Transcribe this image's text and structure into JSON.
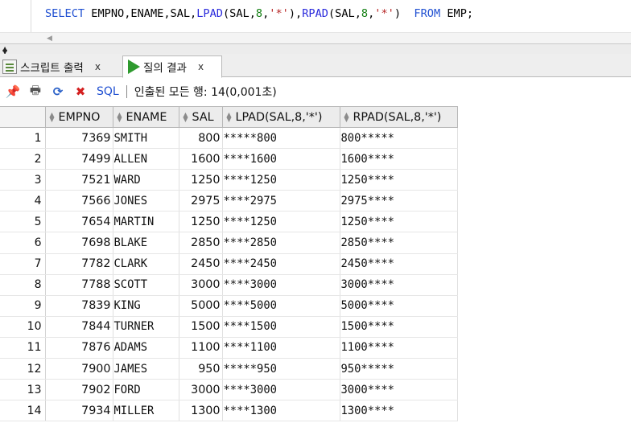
{
  "editor": {
    "sql_tokens": [
      {
        "t": "SELECT ",
        "c": "kw"
      },
      {
        "t": "EMPNO,ENAME,SAL,",
        "c": ""
      },
      {
        "t": "LPAD",
        "c": "fn"
      },
      {
        "t": "(SAL,",
        "c": ""
      },
      {
        "t": "8",
        "c": "num"
      },
      {
        "t": ",",
        "c": ""
      },
      {
        "t": "'*'",
        "c": "str"
      },
      {
        "t": "),",
        "c": ""
      },
      {
        "t": "RPAD",
        "c": "fn"
      },
      {
        "t": "(SAL,",
        "c": ""
      },
      {
        "t": "8",
        "c": "num"
      },
      {
        "t": ",",
        "c": ""
      },
      {
        "t": "'*'",
        "c": "str"
      },
      {
        "t": ")  ",
        "c": ""
      },
      {
        "t": "FROM ",
        "c": "kw"
      },
      {
        "t": "EMP;",
        "c": ""
      }
    ]
  },
  "tabs": [
    {
      "label": "스크립트 출력",
      "close": "x",
      "icon": "script-output-icon"
    },
    {
      "label": "질의 결과",
      "close": "x",
      "icon": "run-query-icon"
    }
  ],
  "toolbar": {
    "sql_label": "SQL",
    "status": "인출된 모든 행: 14(0,001초)",
    "icons": [
      "pin-icon",
      "print-icon",
      "refresh-icon",
      "delete-icon"
    ]
  },
  "grid": {
    "columns": [
      "EMPNO",
      "ENAME",
      "SAL",
      "LPAD(SAL,8,'*')",
      "RPAD(SAL,8,'*')"
    ],
    "rows": [
      [
        "1",
        "7369",
        "SMITH",
        "800",
        "*****800",
        "800*****"
      ],
      [
        "2",
        "7499",
        "ALLEN",
        "1600",
        "****1600",
        "1600****"
      ],
      [
        "3",
        "7521",
        "WARD",
        "1250",
        "****1250",
        "1250****"
      ],
      [
        "4",
        "7566",
        "JONES",
        "2975",
        "****2975",
        "2975****"
      ],
      [
        "5",
        "7654",
        "MARTIN",
        "1250",
        "****1250",
        "1250****"
      ],
      [
        "6",
        "7698",
        "BLAKE",
        "2850",
        "****2850",
        "2850****"
      ],
      [
        "7",
        "7782",
        "CLARK",
        "2450",
        "****2450",
        "2450****"
      ],
      [
        "8",
        "7788",
        "SCOTT",
        "3000",
        "****3000",
        "3000****"
      ],
      [
        "9",
        "7839",
        "KING",
        "5000",
        "****5000",
        "5000****"
      ],
      [
        "10",
        "7844",
        "TURNER",
        "1500",
        "****1500",
        "1500****"
      ],
      [
        "11",
        "7876",
        "ADAMS",
        "1100",
        "****1100",
        "1100****"
      ],
      [
        "12",
        "7900",
        "JAMES",
        "950",
        "*****950",
        "950*****"
      ],
      [
        "13",
        "7902",
        "FORD",
        "3000",
        "****3000",
        "3000****"
      ],
      [
        "14",
        "7934",
        "MILLER",
        "1300",
        "****1300",
        "1300****"
      ]
    ]
  }
}
